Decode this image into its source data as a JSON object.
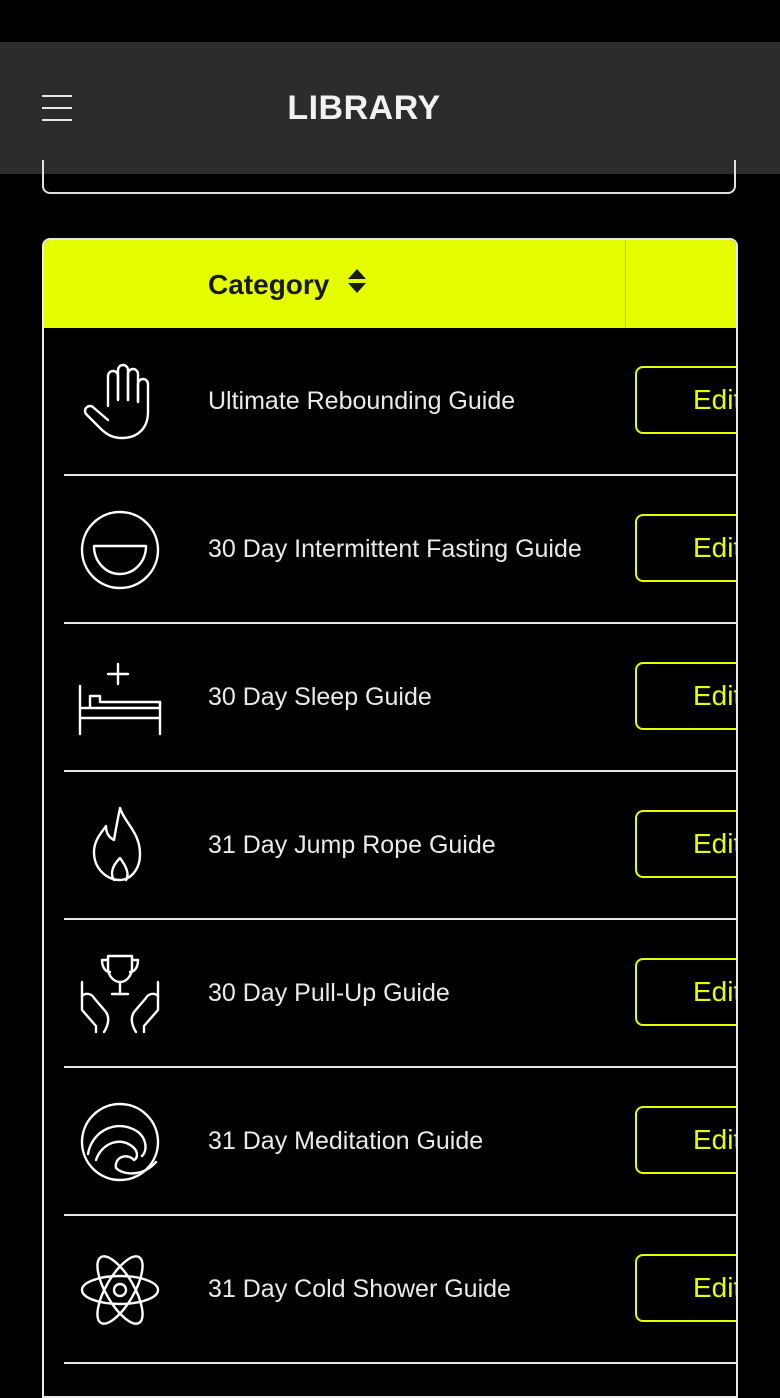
{
  "header": {
    "title": "LIBRARY",
    "menu_icon": "hamburger-menu-icon"
  },
  "table": {
    "column_header": "Category",
    "sort_icon": "sort-up-down-icon",
    "accent_color": "#e6ff00",
    "rows": [
      {
        "label": "Ultimate Rebounding Guide",
        "icon": "hand-icon",
        "action": "Edit"
      },
      {
        "label": "30 Day Intermittent Fasting Guide",
        "icon": "bowl-smile-icon",
        "action": "Edit"
      },
      {
        "label": "30 Day Sleep Guide",
        "icon": "bed-icon",
        "action": "Edit"
      },
      {
        "label": "31 Day Jump Rope Guide",
        "icon": "flame-icon",
        "action": "Edit"
      },
      {
        "label": "30 Day Pull-Up Guide",
        "icon": "trophy-hands-icon",
        "action": "Edit"
      },
      {
        "label": "31 Day Meditation Guide",
        "icon": "wave-swirl-icon",
        "action": "Edit"
      },
      {
        "label": "31 Day Cold Shower Guide",
        "icon": "atom-icon",
        "action": "Edit"
      }
    ]
  }
}
